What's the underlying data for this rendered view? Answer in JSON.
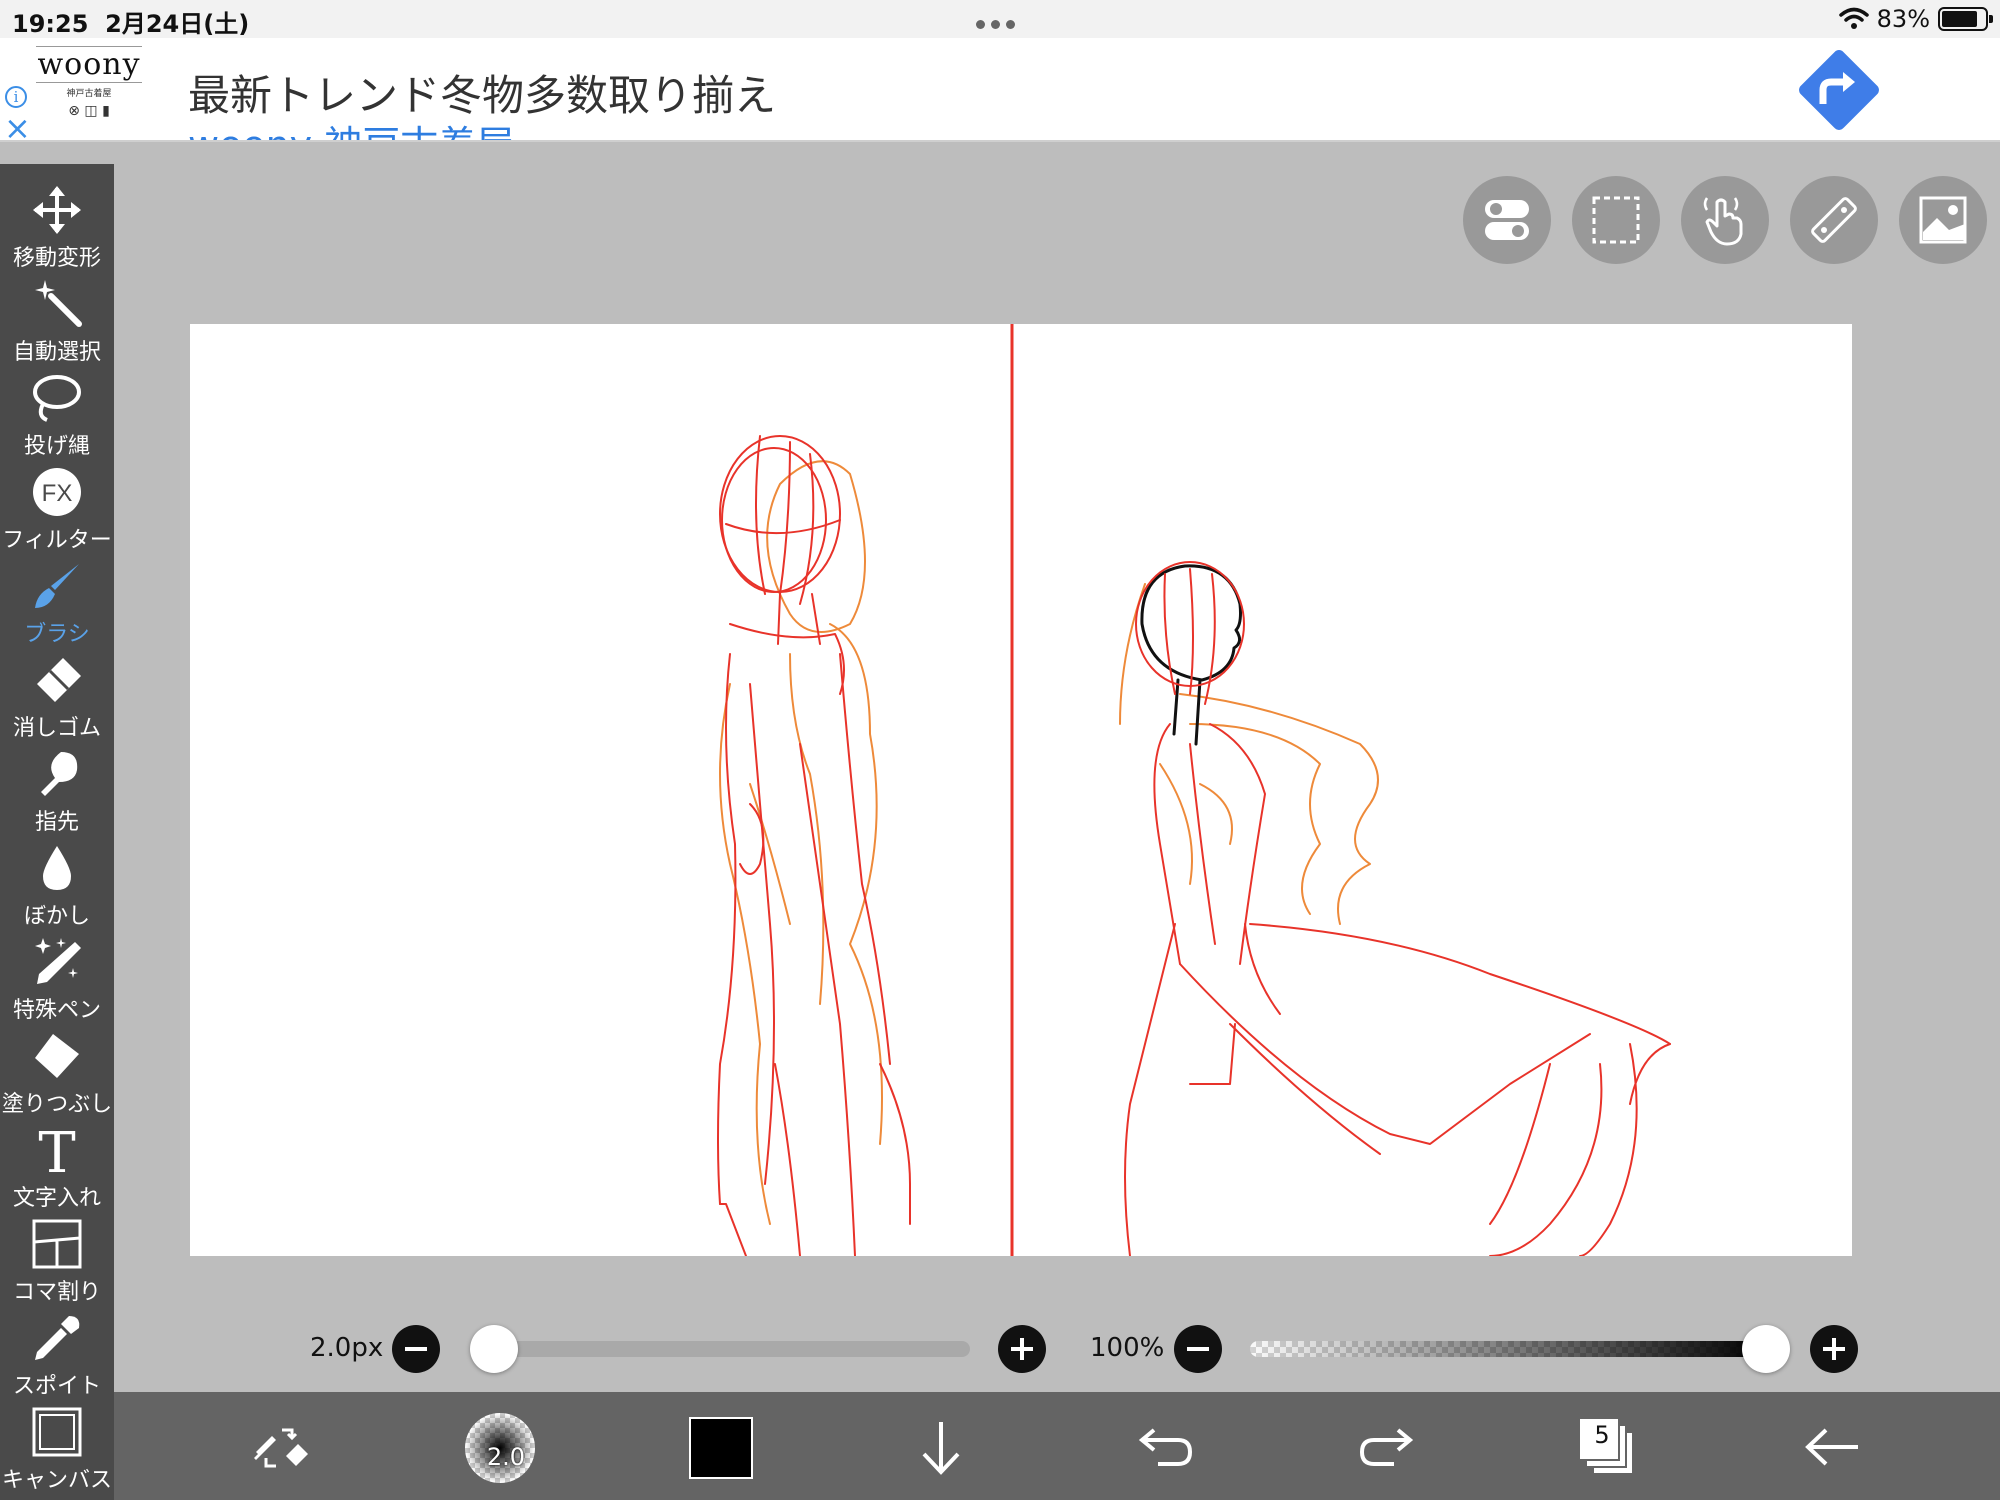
{
  "status": {
    "time": "19:25",
    "date": "2月24日(土)",
    "battery_percent": "83%",
    "battery_level": 0.83
  },
  "ad": {
    "logo_brand": "woony",
    "logo_sub": "神戸古着屋",
    "logo_marks": "⊗ ◫ ▮",
    "headline": "最新トレンド冬物多数取り揃え",
    "subtitle": "woony 神戸古着屋",
    "info_icon": "i",
    "close_icon": "×"
  },
  "tools": [
    {
      "name": "move",
      "label": "移動変形",
      "icon": "move-arrows-icon"
    },
    {
      "name": "magic-wand",
      "label": "自動選択",
      "icon": "magic-wand-icon"
    },
    {
      "name": "lasso",
      "label": "投げ縄",
      "icon": "lasso-icon"
    },
    {
      "name": "filter",
      "label": "フィルター",
      "icon": "fx-icon"
    },
    {
      "name": "brush",
      "label": "ブラシ",
      "icon": "brush-icon",
      "active": true
    },
    {
      "name": "eraser",
      "label": "消しゴム",
      "icon": "eraser-icon"
    },
    {
      "name": "finger",
      "label": "指先",
      "icon": "finger-icon"
    },
    {
      "name": "blur",
      "label": "ぼかし",
      "icon": "droplet-icon"
    },
    {
      "name": "special-pen",
      "label": "特殊ペン",
      "icon": "sparkle-pen-icon"
    },
    {
      "name": "fill",
      "label": "塗りつぶし",
      "icon": "bucket-icon"
    },
    {
      "name": "text",
      "label": "文字入れ",
      "icon": "text-icon"
    },
    {
      "name": "frame-divider",
      "label": "コマ割り",
      "icon": "panels-icon"
    },
    {
      "name": "eyedropper",
      "label": "スポイト",
      "icon": "eyedropper-icon"
    },
    {
      "name": "canvas",
      "label": "キャンバス",
      "icon": "canvas-icon"
    }
  ],
  "top_buttons": [
    "toggle-icon",
    "selection-icon",
    "touch-icon",
    "ruler-icon",
    "material-icon"
  ],
  "brush": {
    "size_label": "2.0px",
    "size_value": 2.0,
    "size_fraction": 0.0,
    "preview_label": "2.0",
    "opacity_label": "100%",
    "opacity_fraction": 1.0
  },
  "bottom": {
    "color": "#000000",
    "layer_count": "5"
  },
  "colors": {
    "toolbar_bg": "#4a4a4a",
    "bottombar_bg": "#646464",
    "workspace_bg": "#bdbdbd",
    "active_tool": "#5aa2e8",
    "sketch_red": "#e83a28",
    "sketch_orange": "#ee8a3a"
  }
}
